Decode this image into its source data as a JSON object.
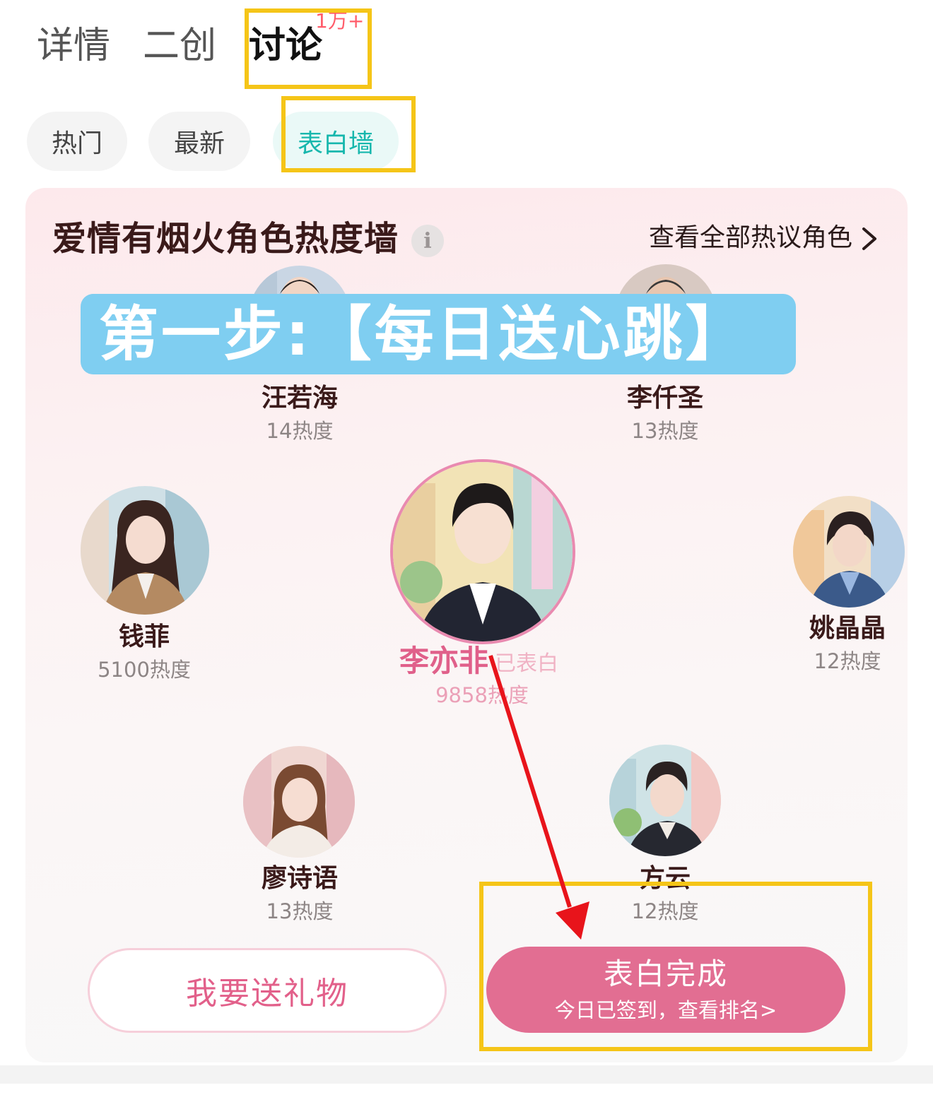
{
  "tabs": [
    {
      "label": "详情"
    },
    {
      "label": "二创"
    },
    {
      "label": "讨论",
      "badge": "1万+"
    }
  ],
  "subtabs": [
    {
      "label": "热门"
    },
    {
      "label": "最新"
    },
    {
      "label": "表白墙",
      "active": true
    }
  ],
  "wall": {
    "title": "爱情有烟火角色热度墙",
    "info_icon": "i",
    "view_all": "查看全部热议角色"
  },
  "characters": [
    {
      "name": "汪若海",
      "heat": "14热度"
    },
    {
      "name": "李仟圣",
      "heat": "13热度"
    },
    {
      "name": "钱菲",
      "heat": "5100热度"
    },
    {
      "name": "李亦非",
      "heat": "9858热度",
      "status": "已表白",
      "highlight_color": "#e0608a"
    },
    {
      "name": "姚晶晶",
      "heat": "12热度"
    },
    {
      "name": "廖诗语",
      "heat": "13热度"
    },
    {
      "name": "方云",
      "heat": "12热度"
    }
  ],
  "annotation": {
    "banner_text": "第一步:【每日送心跳】",
    "box_color": "#f5c518",
    "arrow_color": "#e8141b",
    "banner_color": "#7fcef1"
  },
  "buttons": {
    "gift": "我要送礼物",
    "done_main": "表白完成",
    "done_sub": "今日已签到，查看排名>"
  },
  "colors": {
    "accent_teal": "#17b7ad",
    "accent_pink": "#e26e92",
    "badge_red": "#ff5c6a"
  }
}
